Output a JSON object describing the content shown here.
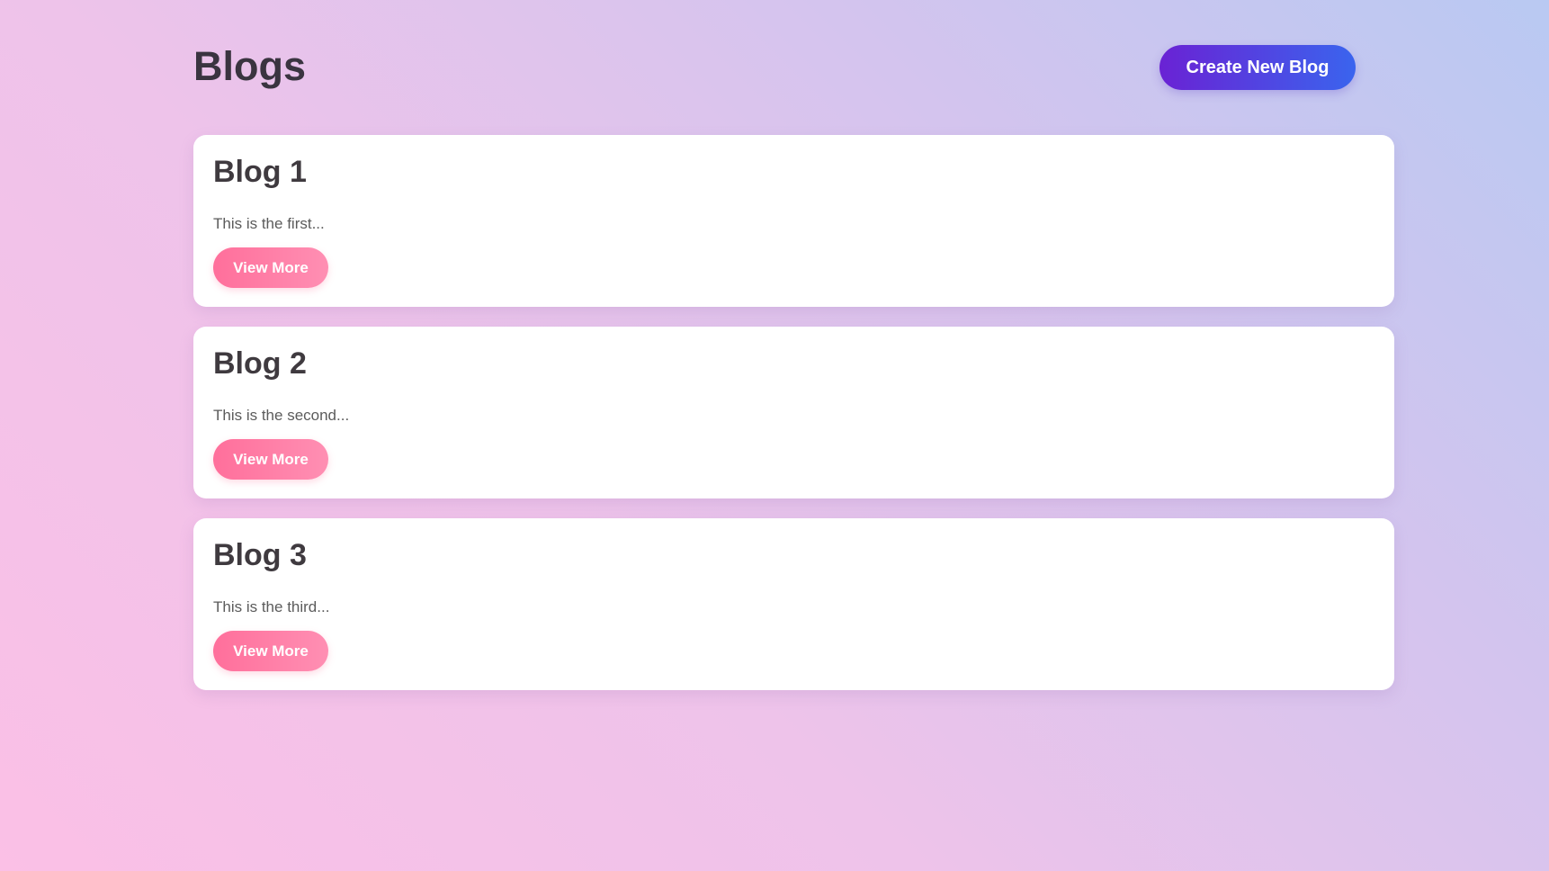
{
  "header": {
    "title": "Blogs",
    "create_label": "Create New Blog"
  },
  "blogs": [
    {
      "title": "Blog 1",
      "excerpt": "This is the first...",
      "button_label": "View More"
    },
    {
      "title": "Blog 2",
      "excerpt": "This is the second...",
      "button_label": "View More"
    },
    {
      "title": "Blog 3",
      "excerpt": "This is the third...",
      "button_label": "View More"
    }
  ],
  "colors": {
    "create_button_start": "#6a22d4",
    "create_button_end": "#3a64ee",
    "view_button": "#ff7aa2",
    "card_background": "#ffffff"
  }
}
